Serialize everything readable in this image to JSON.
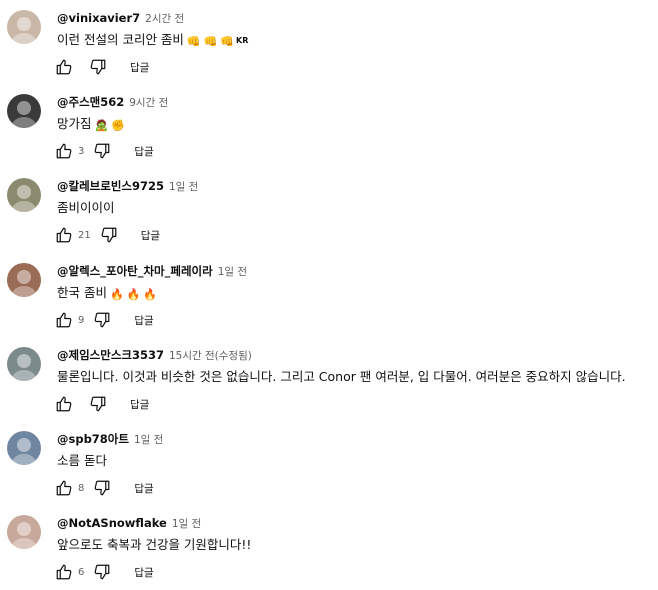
{
  "comments": [
    {
      "author": "@vinixavier7",
      "time": "2시간 전",
      "text": "이런 전설의 코리안 좀비",
      "emoji": [
        "👊",
        "👊",
        "👊"
      ],
      "flag": "KR",
      "likes": "",
      "reply_label": "답글",
      "avatar_color": "#c9b8a8"
    },
    {
      "author": "@주스맨562",
      "time": "9시간 전",
      "text": "망가짐",
      "emoji": [
        "🧟",
        "✊"
      ],
      "flag": "",
      "likes": "3",
      "reply_label": "답글",
      "avatar_color": "#3a3a3a"
    },
    {
      "author": "@칼레브로빈스9725",
      "time": "1일 전",
      "text": "좀비이이이",
      "emoji": [],
      "flag": "",
      "likes": "21",
      "reply_label": "답글",
      "avatar_color": "#8c8a6e"
    },
    {
      "author": "@알렉스_포아탄_차마_페레이라",
      "time": "1일 전",
      "text": "한국 좀비",
      "emoji": [
        "🔥",
        "🔥",
        "🔥"
      ],
      "flag": "",
      "likes": "9",
      "reply_label": "답글",
      "avatar_color": "#9a6b55"
    },
    {
      "author": "@제임스만스크3537",
      "time": "15시간 전(수정됨)",
      "text": "물론입니다. 이것과 비슷한 것은 없습니다. 그리고 Conor 팬 여러분, 입 다물어. 여러분은 중요하지 않습니다.",
      "emoji": [],
      "flag": "",
      "likes": "",
      "reply_label": "답글",
      "avatar_color": "#7d8a8c"
    },
    {
      "author": "@spb78아트",
      "time": "1일 전",
      "text": "소름 돋다",
      "emoji": [],
      "flag": "",
      "likes": "8",
      "reply_label": "답글",
      "avatar_color": "#6f86a0"
    },
    {
      "author": "@NotASnowflake",
      "time": "1일 전",
      "text": "앞으로도 축복과 건강을 기원합니다!!",
      "emoji": [],
      "flag": "",
      "likes": "6",
      "reply_label": "답글",
      "avatar_color": "#c8a89a"
    }
  ],
  "icons": {
    "like": "thumb-up-icon",
    "dislike": "thumb-down-icon"
  }
}
